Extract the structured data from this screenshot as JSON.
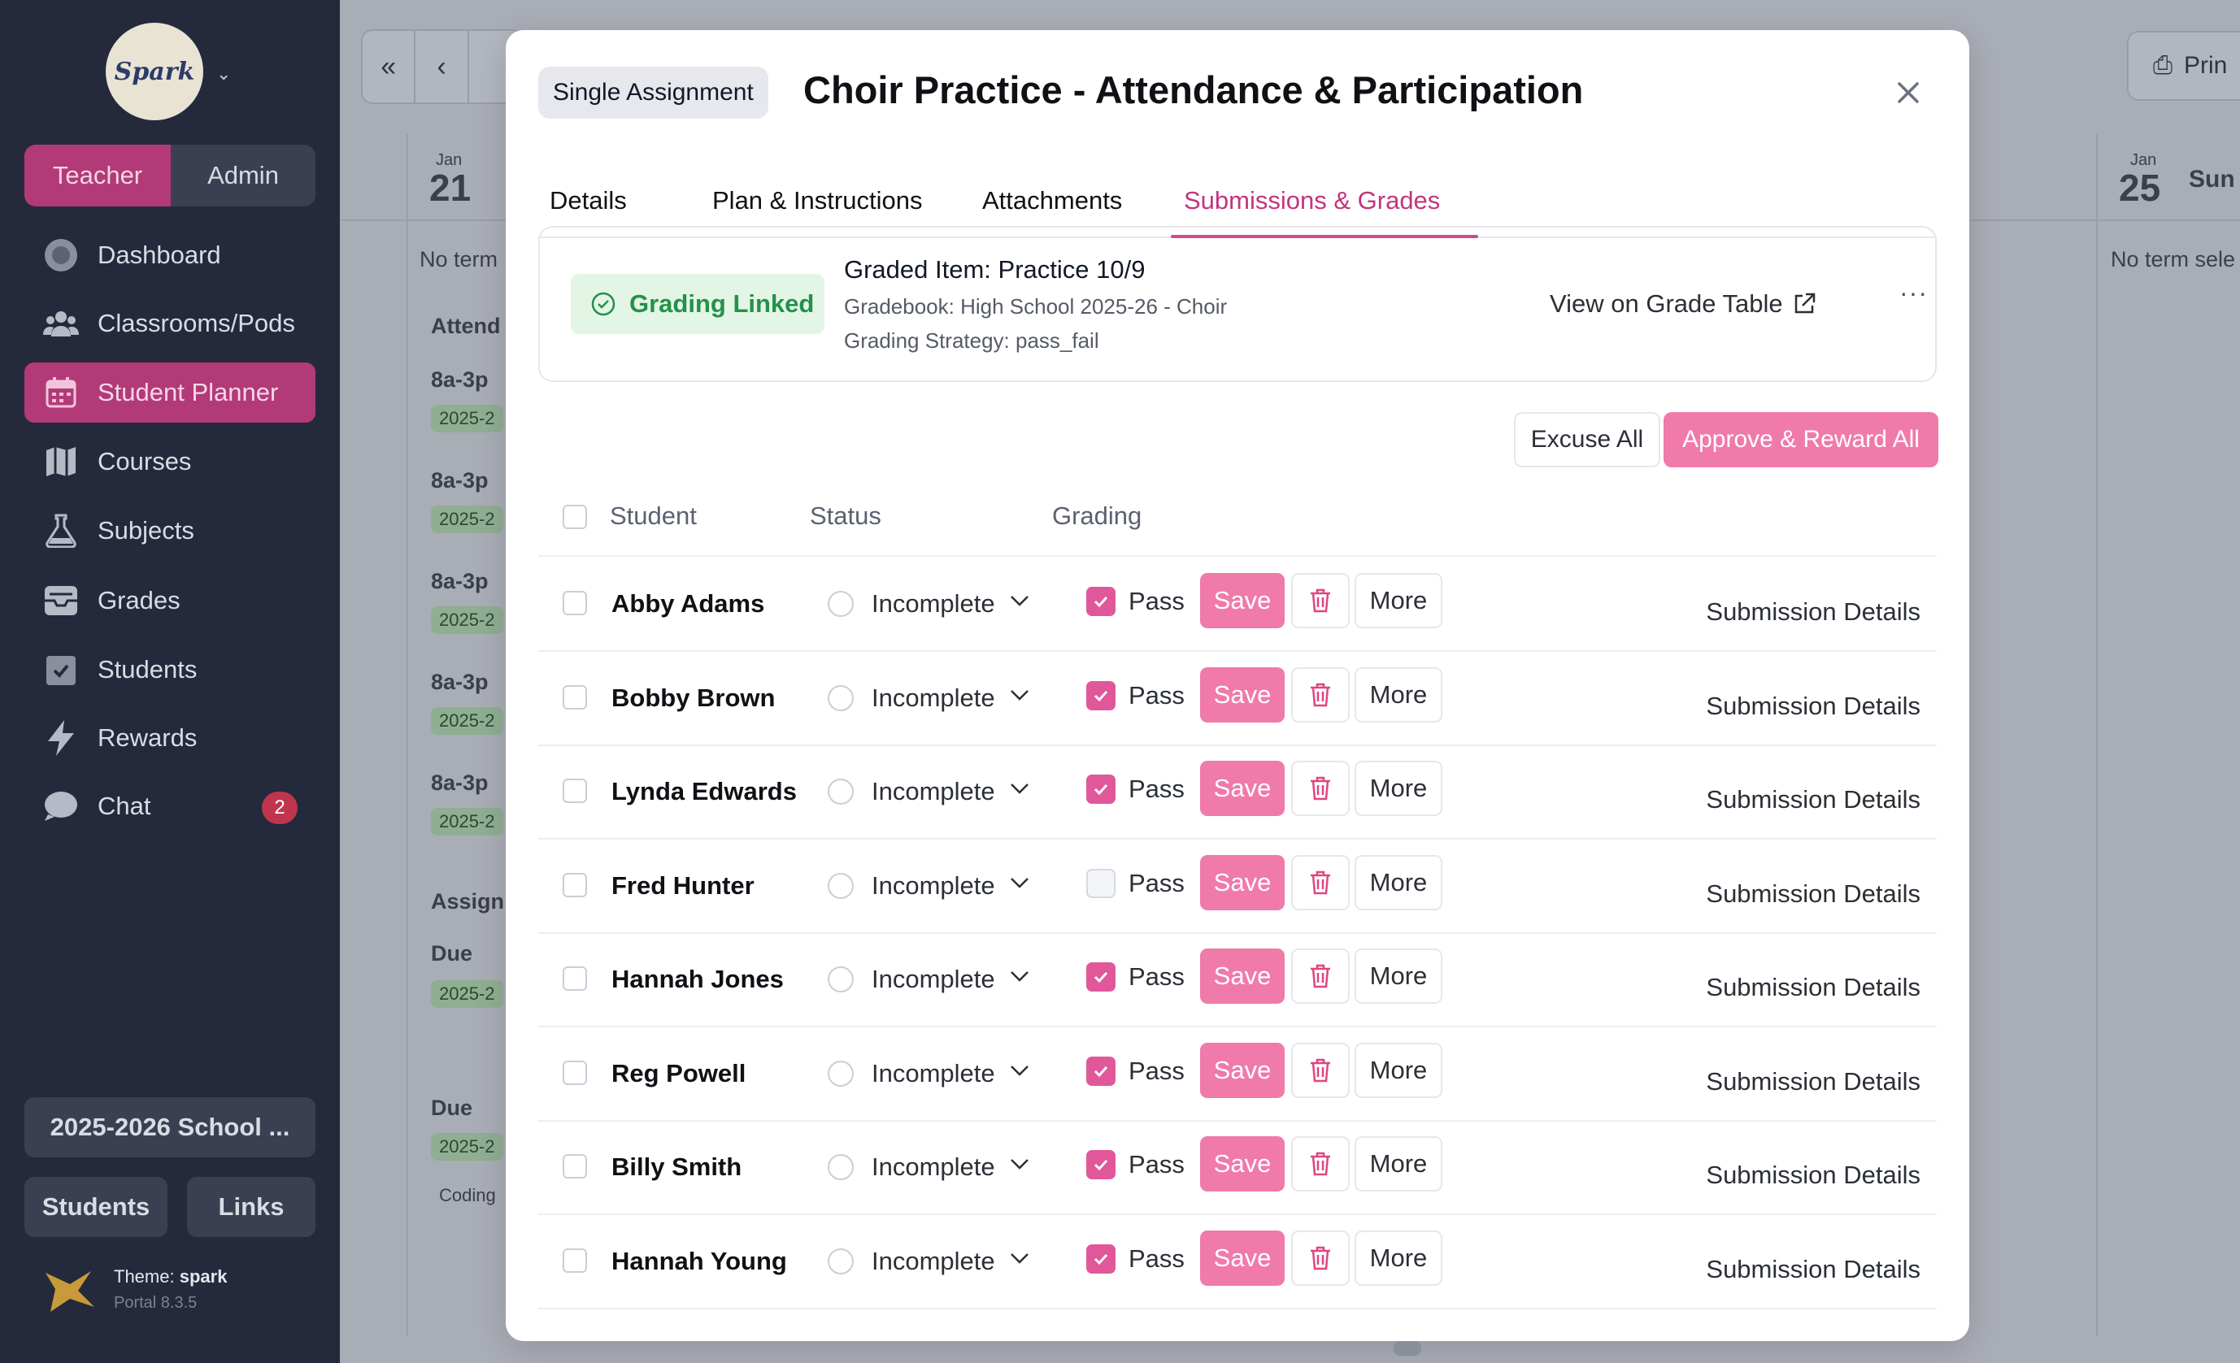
{
  "sidebar": {
    "logo_text": "Spark",
    "roles": [
      "Teacher",
      "Admin"
    ],
    "active_role": "Teacher",
    "nav": [
      {
        "label": "Dashboard",
        "icon": "dashboard-icon"
      },
      {
        "label": "Classrooms/Pods",
        "icon": "users-icon"
      },
      {
        "label": "Student Planner",
        "icon": "calendar-icon",
        "active": true
      },
      {
        "label": "Courses",
        "icon": "map-icon"
      },
      {
        "label": "Subjects",
        "icon": "flask-icon"
      },
      {
        "label": "Grades",
        "icon": "inbox-icon"
      },
      {
        "label": "Students",
        "icon": "clipboard-check-icon"
      },
      {
        "label": "Rewards",
        "icon": "lightning-icon"
      },
      {
        "label": "Chat",
        "icon": "chat-icon",
        "badge": "2"
      }
    ],
    "school_year": "2025-2026 School ...",
    "students_btn": "Students",
    "links_btn": "Links",
    "theme_label": "Theme:",
    "theme_name": "spark",
    "portal_version": "Portal 8.3.5"
  },
  "background": {
    "print_label": "Prin",
    "day1_month": "Jan",
    "day1_num": "21",
    "day2_month": "Jan",
    "day2_num": "25",
    "day2_name": "Sun",
    "no_term": "No term",
    "no_term_select": "No term sele",
    "attend": "Attend",
    "assign": "Assign",
    "time": "8a-3p",
    "due": "Due",
    "coding": "Coding",
    "chip_year": "2025-2"
  },
  "modal": {
    "type_chip": "Single Assignment",
    "title": "Choir Practice - Attendance & Participation",
    "tabs": [
      "Details",
      "Plan & Instructions",
      "Attachments",
      "Submissions & Grades"
    ],
    "active_tab": "Submissions & Grades",
    "grading": {
      "status": "Grading Linked",
      "graded_item": "Graded Item: Practice 10/9",
      "gradebook": "Gradebook: High School 2025-26 - Choir",
      "strategy": "Grading Strategy: pass_fail",
      "view_link": "View on Grade Table",
      "menu": "···"
    },
    "excuse_all": "Excuse All",
    "approve_all": "Approve & Reward All",
    "columns": {
      "student": "Student",
      "status": "Status",
      "grading": "Grading"
    },
    "row_labels": {
      "pass": "Pass",
      "save": "Save",
      "more": "More",
      "details": "Submission Details"
    },
    "students": [
      {
        "name": "Abby Adams",
        "status": "Incomplete",
        "pass": true
      },
      {
        "name": "Bobby Brown",
        "status": "Incomplete",
        "pass": true
      },
      {
        "name": "Lynda Edwards",
        "status": "Incomplete",
        "pass": true
      },
      {
        "name": "Fred Hunter",
        "status": "Incomplete",
        "pass": false
      },
      {
        "name": "Hannah Jones",
        "status": "Incomplete",
        "pass": true
      },
      {
        "name": "Reg Powell",
        "status": "Incomplete",
        "pass": true
      },
      {
        "name": "Billy Smith",
        "status": "Incomplete",
        "pass": true
      },
      {
        "name": "Hannah Young",
        "status": "Incomplete",
        "pass": true
      }
    ]
  },
  "colors": {
    "accent": "#b23a78",
    "accent_light": "#f07aaa",
    "success": "#24914a",
    "sidebar_bg": "#242a3b"
  }
}
